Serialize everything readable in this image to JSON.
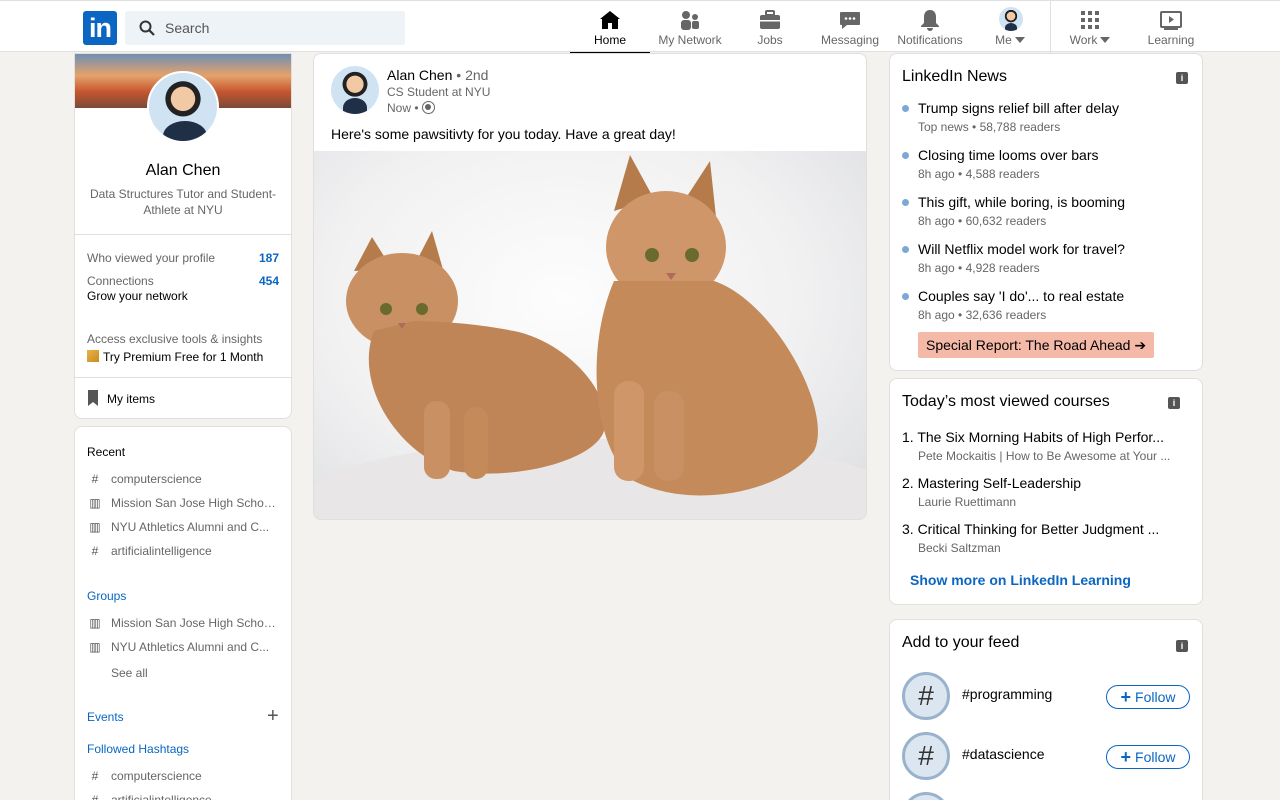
{
  "search": {
    "placeholder": "Search"
  },
  "nav": [
    {
      "label": "Home",
      "icon": "home-icon"
    },
    {
      "label": "My Network",
      "icon": "network-icon"
    },
    {
      "label": "Jobs",
      "icon": "briefcase-icon"
    },
    {
      "label": "Messaging",
      "icon": "messaging-icon"
    },
    {
      "label": "Notifications",
      "icon": "bell-icon"
    },
    {
      "label": "Me",
      "icon": "avatar"
    },
    {
      "label": "Work",
      "icon": "grid-icon"
    },
    {
      "label": "Learning",
      "icon": "learning-icon"
    }
  ],
  "profile": {
    "name": "Alan Chen",
    "headline": "Data Structures Tutor and Student-Athlete at NYU",
    "viewed_label": "Who viewed your profile",
    "viewed_value": "187",
    "connections_label": "Connections",
    "connections_value": "454",
    "grow_label": "Grow your network",
    "premium_prompt": "Access exclusive tools & insights",
    "premium_link": "Try Premium Free for 1 Month",
    "my_items": "My items"
  },
  "sidebar": {
    "recent_title": "Recent",
    "recent": [
      {
        "glyph": "#",
        "label": "computerscience"
      },
      {
        "glyph": "group",
        "label": "Mission San Jose High Schoo..."
      },
      {
        "glyph": "group",
        "label": "NYU Athletics Alumni and C..."
      },
      {
        "glyph": "#",
        "label": "artificialintelligence"
      }
    ],
    "groups_title": "Groups",
    "groups": [
      {
        "label": "Mission San Jose High Schoo..."
      },
      {
        "label": "NYU Athletics Alumni and C..."
      }
    ],
    "see_all": "See all",
    "events_title": "Events",
    "hashtags_title": "Followed Hashtags",
    "hashtags": [
      "computerscience",
      "artificialintelligence"
    ]
  },
  "post": {
    "author": "Alan Chen",
    "degree": "• 2nd",
    "subtitle": "CS Student at NYU",
    "time": "Now •",
    "text": "Here's some pawsitivty for you today. Have a great day!"
  },
  "news": {
    "title": "LinkedIn News",
    "items": [
      {
        "title": "Trump signs relief bill after delay",
        "meta": "Top news • 58,788 readers"
      },
      {
        "title": "Closing time looms over bars",
        "meta": "8h ago • 4,588 readers"
      },
      {
        "title": "This gift, while boring, is booming",
        "meta": "8h ago • 60,632 readers"
      },
      {
        "title": "Will Netflix model work for travel?",
        "meta": "8h ago • 4,928 readers"
      },
      {
        "title": "Couples say 'I do'... to real estate",
        "meta": "8h ago • 32,636 readers"
      }
    ],
    "special": "Special Report: The Road Ahead"
  },
  "courses": {
    "title": "Today’s most viewed courses",
    "items": [
      {
        "title": "1. The Six Morning Habits of High Perfor...",
        "meta": "Pete Mockaitis | How to Be Awesome at Your ..."
      },
      {
        "title": "2. Mastering Self-Leadership",
        "meta": "Laurie Ruettimann"
      },
      {
        "title": "3. Critical Thinking for Better Judgment ...",
        "meta": "Becki Saltzman"
      }
    ],
    "more": "Show more on LinkedIn Learning"
  },
  "feed": {
    "title": "Add to your feed",
    "items": [
      {
        "name": "#programming",
        "button": "Follow"
      },
      {
        "name": "#datascience",
        "button": "Follow"
      }
    ]
  },
  "colors": {
    "brand": "#0a66c2",
    "background": "#f3f2ef",
    "highlight": "#f5b9a8"
  }
}
